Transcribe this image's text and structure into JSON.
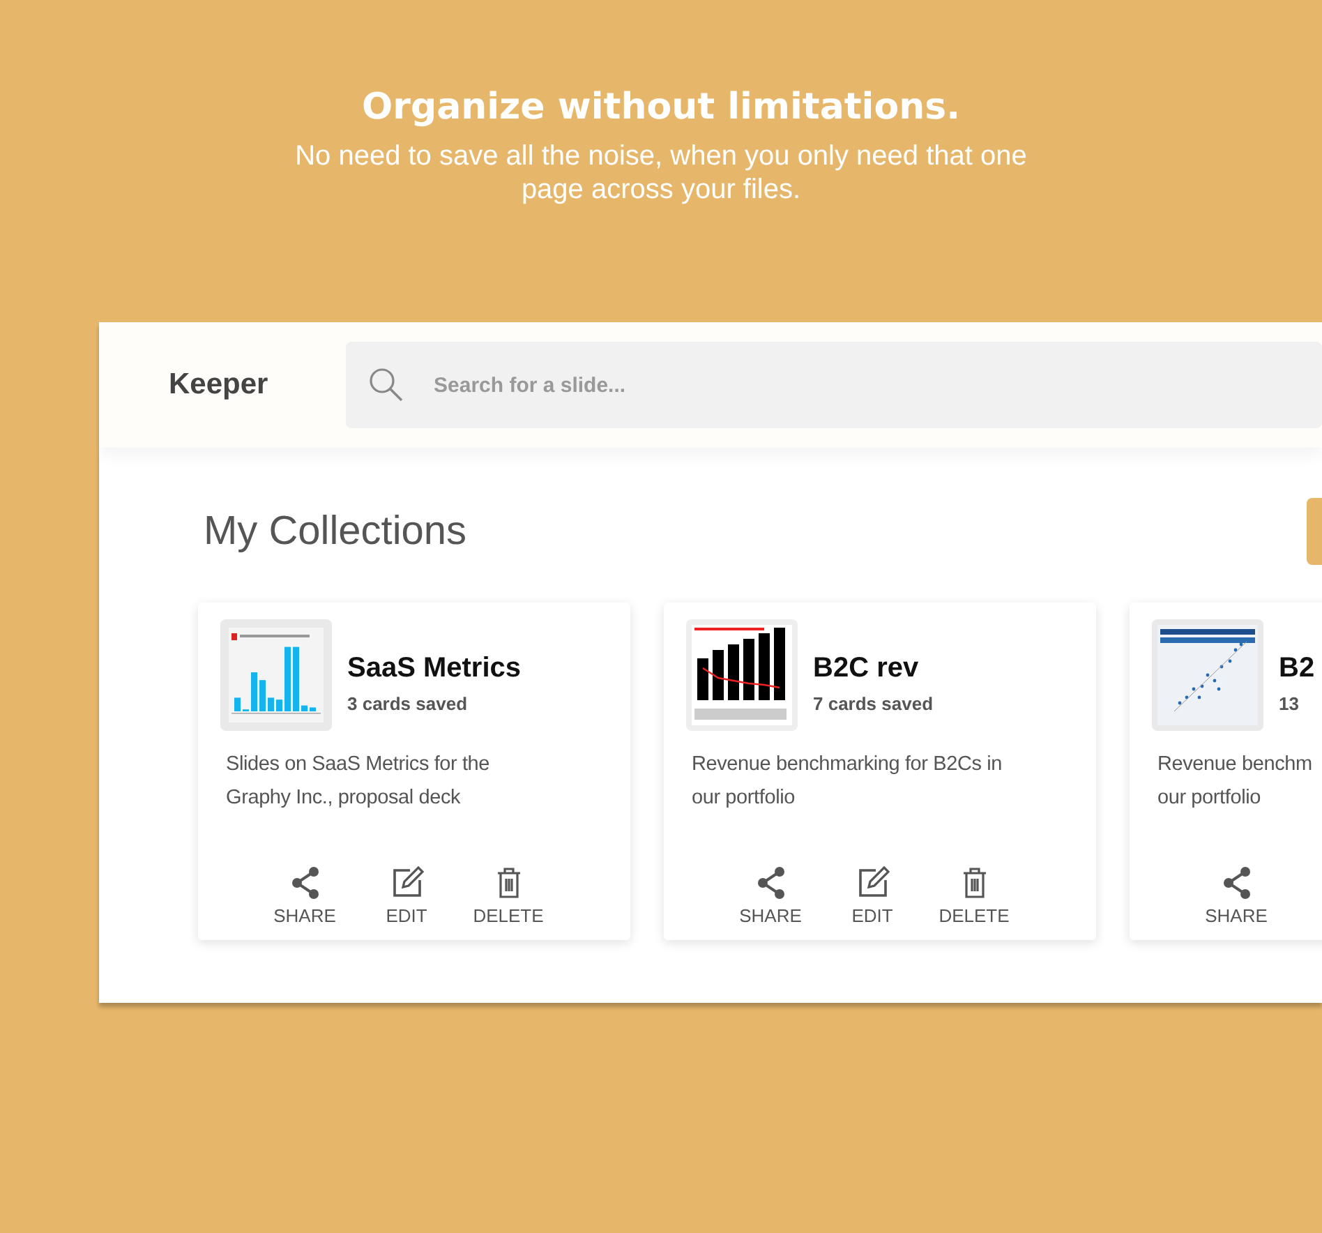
{
  "hero": {
    "title": "Organize without limitations.",
    "subtitle": "No need to save all the noise, when you only need that one page across your files."
  },
  "app": {
    "brand": "Keeper",
    "search": {
      "placeholder": "Search for a slide..."
    },
    "heading": "My Collections",
    "collections": [
      {
        "title": "SaaS Metrics",
        "count": "3 cards saved",
        "description": "Slides on SaaS Metrics for the Graphy Inc., proposal deck",
        "actions": [
          {
            "kind": "share",
            "label": "SHARE"
          },
          {
            "kind": "edit",
            "label": "EDIT"
          },
          {
            "kind": "delete",
            "label": "DELETE"
          }
        ]
      },
      {
        "title": "B2C rev",
        "count": "7 cards saved",
        "description": "Revenue benchmarking for B2Cs in our portfolio",
        "actions": [
          {
            "kind": "share",
            "label": "SHARE"
          },
          {
            "kind": "edit",
            "label": "EDIT"
          },
          {
            "kind": "delete",
            "label": "DELETE"
          }
        ]
      },
      {
        "title": "B2",
        "count": "13",
        "description": "Revenue benchm\nour portfolio",
        "actions": [
          {
            "kind": "share",
            "label": "SHARE"
          }
        ]
      }
    ]
  }
}
